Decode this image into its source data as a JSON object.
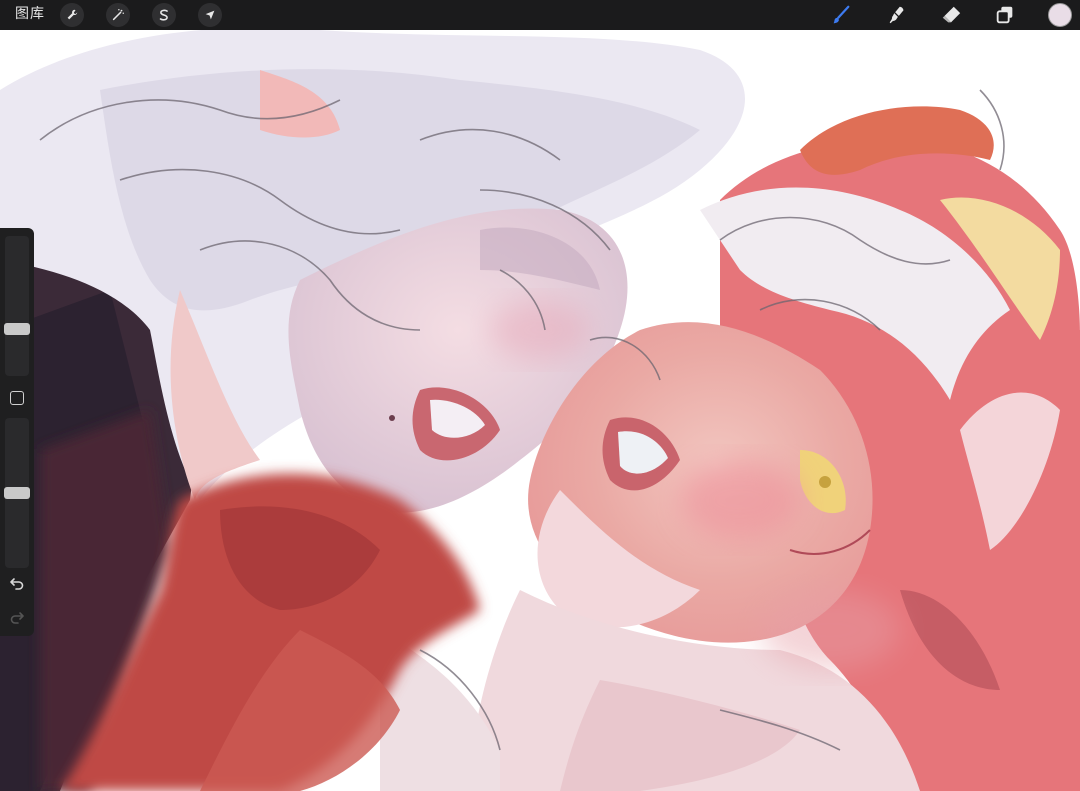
{
  "topbar": {
    "gallery_label": "图库",
    "left_tools": [
      "wrench-icon",
      "magic-wand-icon",
      "selection-s-icon",
      "arrow-cursor-icon"
    ],
    "right_tools": [
      "brush-icon",
      "smudge-icon",
      "eraser-icon",
      "layers-icon"
    ],
    "active_tool": "brush-icon",
    "current_color": "#e9dde7",
    "accent_color": "#3d7bf0"
  },
  "sidebar": {
    "brush_size_level": 0.32,
    "opacity_level": 0.5,
    "undo_icon": "undo-icon",
    "redo_icon": "redo-icon",
    "modify_icon": "square-modify-icon"
  },
  "canvas": {
    "background": "#ffffff"
  }
}
